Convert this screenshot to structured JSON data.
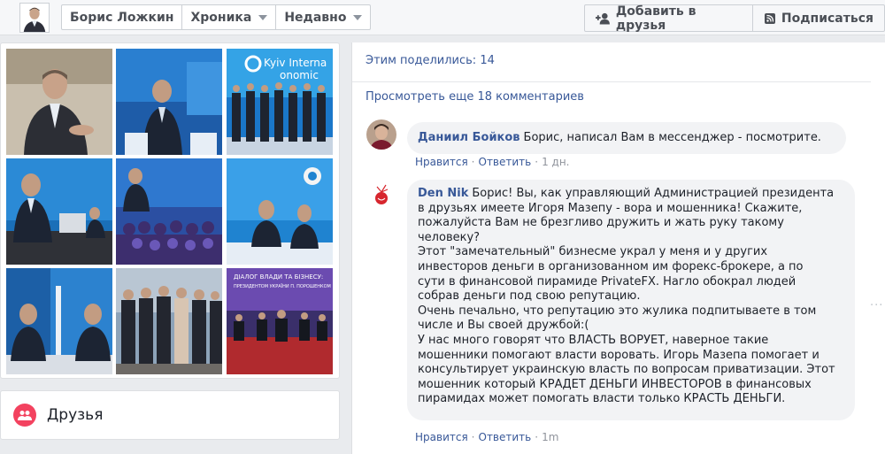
{
  "profile": {
    "name": "Борис Ложкин",
    "tab": "Хроника",
    "filter": "Недавно"
  },
  "actions": {
    "add_friend": "Добавить в друзья",
    "follow": "Подписаться"
  },
  "friends_card": {
    "title": "Друзья"
  },
  "post": {
    "shares": "Этим поделились: 14",
    "view_more": "Просмотреть еще 18 комментариев"
  },
  "comments": [
    {
      "author": "Даниил Бойков",
      "text": "Борис, написал Вам в мессенджер - посмотрите.",
      "like": "Нравится",
      "reply": "Ответить",
      "time": "1 дн."
    },
    {
      "author": "Den Nik",
      "text": "Борис! Вы, как управляющий Администрацией президента\nв друзьях имеете Игоря Мазепу - вора и мошенника! Скажите,\nпожалуйста Вам не брезгливо дружить и жать руку такому человеку?\nЭтот \"замечательный\" бизнесме украл у меня и у других\nинвесторов деньги в организованном им форекс-брокере, а по\nсути в финансовой пирамиде PrivateFX. Нагло обокрал людей\nсобрав деньги под свою репутацию.\nОчень печально, что репутацию это жулика подпитываете в том\nчисле и Вы своей дружбой:(\nУ нас много говорят что ВЛАСТЬ ВОРУЕТ, наверное такие\nмошенники помогают власти воровать. Игорь Мазепа помогает и\nконсультирует украинскую власть по вопросам приватизации. Этот\nмошенник который КРАДЕТ ДЕНЬГИ ИНВЕСТОРОВ в финансовых\nпирамидах может помогать власти только КРАСТЬ ДЕНЬГИ.",
      "like": "Нравится",
      "reply": "Ответить",
      "time": "1m"
    }
  ],
  "photo_overlay_texts": {
    "photo3": "Kyiv Interna\nonomic",
    "photo9": "ДІАЛОГ ВЛАДИ ТА БІЗНЕСУ:\nПРЕЗИДЕНТОМ УКРАЇНИ П. ПОРОШЕНКОМ"
  },
  "colors": {
    "link": "#385898",
    "friends_badge": "#f3425f",
    "page_bg": "#e9ebee"
  }
}
